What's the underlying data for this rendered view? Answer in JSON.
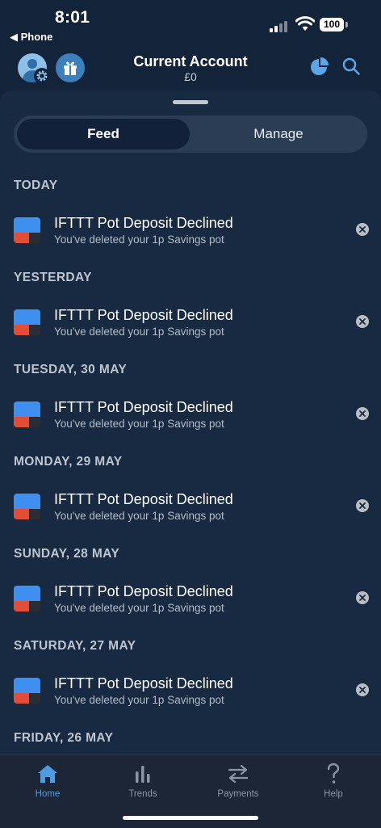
{
  "status_bar": {
    "time": "8:01",
    "back_app": "◀ Phone",
    "battery": "100"
  },
  "header": {
    "title": "Current Account",
    "balance": "£0"
  },
  "tabs": {
    "feed": "Feed",
    "manage": "Manage"
  },
  "feed": [
    {
      "date": "TODAY",
      "title": "IFTTT Pot Deposit Declined",
      "subtitle": "You've deleted your 1p Savings pot"
    },
    {
      "date": "YESTERDAY",
      "title": "IFTTT Pot Deposit Declined",
      "subtitle": "You've deleted your 1p Savings pot"
    },
    {
      "date": "TUESDAY, 30 MAY",
      "title": "IFTTT Pot Deposit Declined",
      "subtitle": "You've deleted your 1p Savings pot"
    },
    {
      "date": "MONDAY, 29 MAY",
      "title": "IFTTT Pot Deposit Declined",
      "subtitle": "You've deleted your 1p Savings pot"
    },
    {
      "date": "SUNDAY, 28 MAY",
      "title": "IFTTT Pot Deposit Declined",
      "subtitle": "You've deleted your 1p Savings pot"
    },
    {
      "date": "SATURDAY, 27 MAY",
      "title": "IFTTT Pot Deposit Declined",
      "subtitle": "You've deleted your 1p Savings pot"
    },
    {
      "date": "FRIDAY, 26 MAY"
    }
  ],
  "tab_bar": [
    {
      "label": "Home",
      "icon": "home-icon",
      "active": true
    },
    {
      "label": "Trends",
      "icon": "trends-icon",
      "active": false
    },
    {
      "label": "Payments",
      "icon": "payments-icon",
      "active": false
    },
    {
      "label": "Help",
      "icon": "help-icon",
      "active": false
    }
  ],
  "colors": {
    "background": "#13233a",
    "sheet": "#182a41",
    "accent": "#4d9be0"
  }
}
